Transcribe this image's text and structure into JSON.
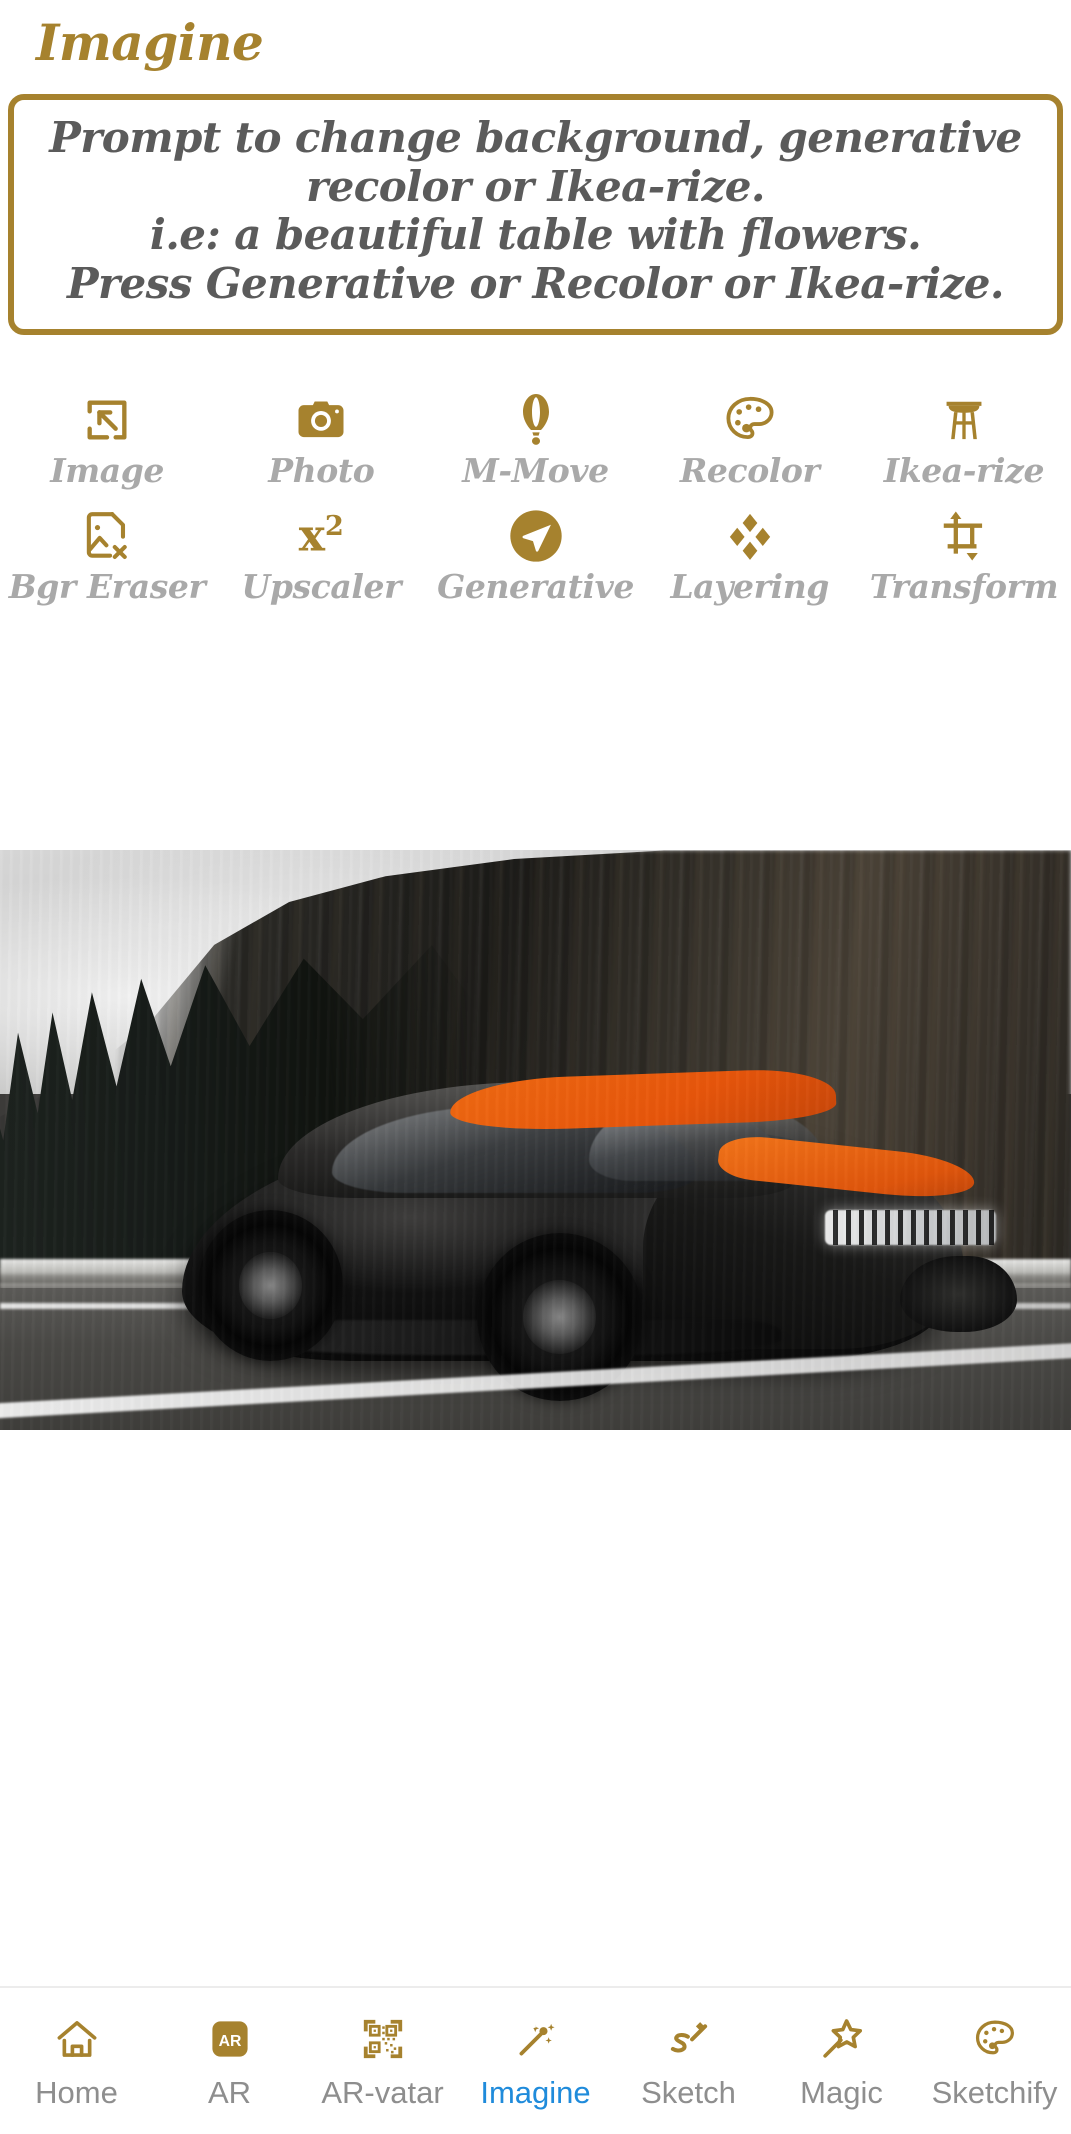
{
  "app": {
    "title": "Imagine",
    "brand_color": "#A6822E",
    "active_tab_color": "#1f8bdb",
    "muted_text_color": "#a9a9a9"
  },
  "prompt_box": {
    "line1": "Prompt to change background, generative",
    "line2": "recolor or Ikea-rize.",
    "line3": "i.e: a beautiful table with flowers.",
    "line4": "Press Generative or Recolor or Ikea-rize."
  },
  "tools": {
    "row1": [
      {
        "label": "Image",
        "icon": "image-import-icon"
      },
      {
        "label": "Photo",
        "icon": "camera-icon"
      },
      {
        "label": "M-Move",
        "icon": "hot-air-balloon-icon"
      },
      {
        "label": "Recolor",
        "icon": "palette-icon"
      },
      {
        "label": "Ikea-rize",
        "icon": "stool-icon"
      }
    ],
    "row2": [
      {
        "label": "Bgr Eraser",
        "icon": "image-remove-icon"
      },
      {
        "label": "Upscaler",
        "icon": "x-squared-icon",
        "glyph": "x",
        "exponent": "2"
      },
      {
        "label": "Generative",
        "icon": "send-circle-icon"
      },
      {
        "label": "Layering",
        "icon": "four-diamonds-icon"
      },
      {
        "label": "Transform",
        "icon": "crop-arrows-icon"
      }
    ]
  },
  "canvas": {
    "image_alt": "Black Bugatti Chiron sports car with orange stripe driving fast on a highway with motion-blurred forest and cliff background"
  },
  "bottom_nav": {
    "items": [
      {
        "label": "Home",
        "icon": "home-icon",
        "active": false
      },
      {
        "label": "AR",
        "icon": "ar-badge-icon",
        "active": false
      },
      {
        "label": "AR-vatar",
        "icon": "qr-code-icon",
        "active": false
      },
      {
        "label": "Imagine",
        "icon": "magic-wand-icon",
        "active": true
      },
      {
        "label": "Sketch",
        "icon": "pencil-sketch-icon",
        "active": false
      },
      {
        "label": "Magic",
        "icon": "star-wand-icon",
        "active": false
      },
      {
        "label": "Sketchify",
        "icon": "palette-outline-icon",
        "active": false
      }
    ]
  }
}
